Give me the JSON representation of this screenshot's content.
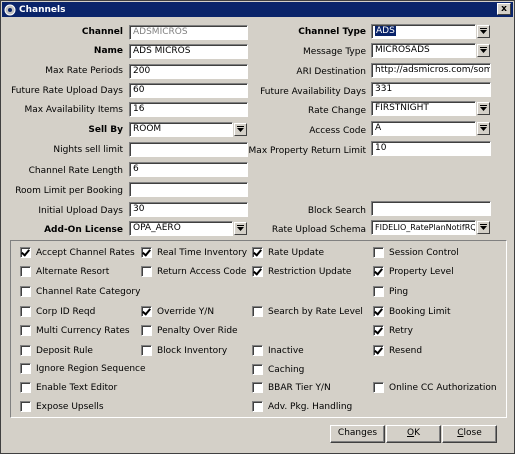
{
  "window": {
    "title": "Channels",
    "close_glyph": "x"
  },
  "left_fields": {
    "channel": {
      "label": "Channel",
      "value": "ADSMICROS"
    },
    "name": {
      "label": "Name",
      "value": "ADS MICROS"
    },
    "max_rate_periods": {
      "label": "Max Rate Periods",
      "value": "200"
    },
    "future_rate_upload_days": {
      "label": "Future Rate Upload Days",
      "value": "60"
    },
    "max_availability_items": {
      "label": "Max Availability Items",
      "value": "16"
    },
    "sell_by": {
      "label": "Sell By",
      "value": "ROOM"
    },
    "nights_sell_limit": {
      "label": "Nights sell limit",
      "value": ""
    },
    "channel_rate_length": {
      "label": "Channel Rate Length",
      "value": "6"
    },
    "room_limit_per_booking": {
      "label": "Room Limit per Booking",
      "value": ""
    },
    "initial_upload_days": {
      "label": "Initial Upload Days",
      "value": "30"
    },
    "add_on_license": {
      "label": "Add-On License",
      "value": "OPA_AERO"
    }
  },
  "right_fields": {
    "channel_type": {
      "label": "Channel Type",
      "value": "ADS"
    },
    "message_type": {
      "label": "Message Type",
      "value": "MICROSADS"
    },
    "ari_destination": {
      "label": "ARI Destination",
      "value": "http://adsmicros.com/some.s"
    },
    "future_availability_days": {
      "label": "Future Availability Days",
      "value": "331"
    },
    "rate_change": {
      "label": "Rate Change",
      "value": "FIRSTNIGHT"
    },
    "access_code": {
      "label": "Access Code",
      "value": "A"
    },
    "max_property_return_limit": {
      "label": "Max Property Return Limit",
      "value": "10"
    },
    "block_search": {
      "label": "Block Search",
      "value": ""
    },
    "rate_upload_schema": {
      "label": "Rate Upload Schema",
      "value": "FIDELIO_RatePlanNotifRQ...."
    }
  },
  "checkboxes": [
    {
      "label": "Accept Channel Rates",
      "checked": true
    },
    {
      "label": "Real Time Inventory",
      "checked": true
    },
    {
      "label": "Rate Update",
      "checked": true
    },
    {
      "label": "Session Control",
      "checked": false
    },
    {
      "label": "Alternate Resort",
      "checked": false
    },
    {
      "label": "Return Access Code",
      "checked": false
    },
    {
      "label": "Restriction Update",
      "checked": true
    },
    {
      "label": "Property Level",
      "checked": true
    },
    {
      "label": "Channel Rate Category",
      "checked": false
    },
    {
      "label": "Ping",
      "checked": false
    },
    {
      "label": "Corp ID Reqd",
      "checked": false
    },
    {
      "label": "Override Y/N",
      "checked": true
    },
    {
      "label": "Search by Rate Level",
      "checked": false
    },
    {
      "label": "Booking Limit",
      "checked": true
    },
    {
      "label": "Multi Currency Rates",
      "checked": false
    },
    {
      "label": "Penalty Over Ride",
      "checked": false
    },
    {
      "label": "Retry",
      "checked": true
    },
    {
      "label": "Deposit Rule",
      "checked": false
    },
    {
      "label": "Block Inventory",
      "checked": false
    },
    {
      "label": "Inactive",
      "checked": false
    },
    {
      "label": "Resend",
      "checked": true
    },
    {
      "label": "Ignore Region Sequence",
      "checked": false
    },
    {
      "label": "Caching",
      "checked": false
    },
    {
      "label": "Enable Text Editor",
      "checked": false
    },
    {
      "label": "BBAR Tier Y/N",
      "checked": false
    },
    {
      "label": "Online CC Authorization",
      "checked": false
    },
    {
      "label": "Expose Upsells",
      "checked": false
    },
    {
      "label": "Adv. Pkg. Handling",
      "checked": false
    }
  ],
  "buttons": {
    "changes": "Changes",
    "ok_rest": "K",
    "ok_mnemonic": "O",
    "close_mnemonic": "C",
    "close_rest": "lose"
  },
  "icons": {
    "dropdown": "down-arrow-icon",
    "app": "window-app-icon"
  }
}
